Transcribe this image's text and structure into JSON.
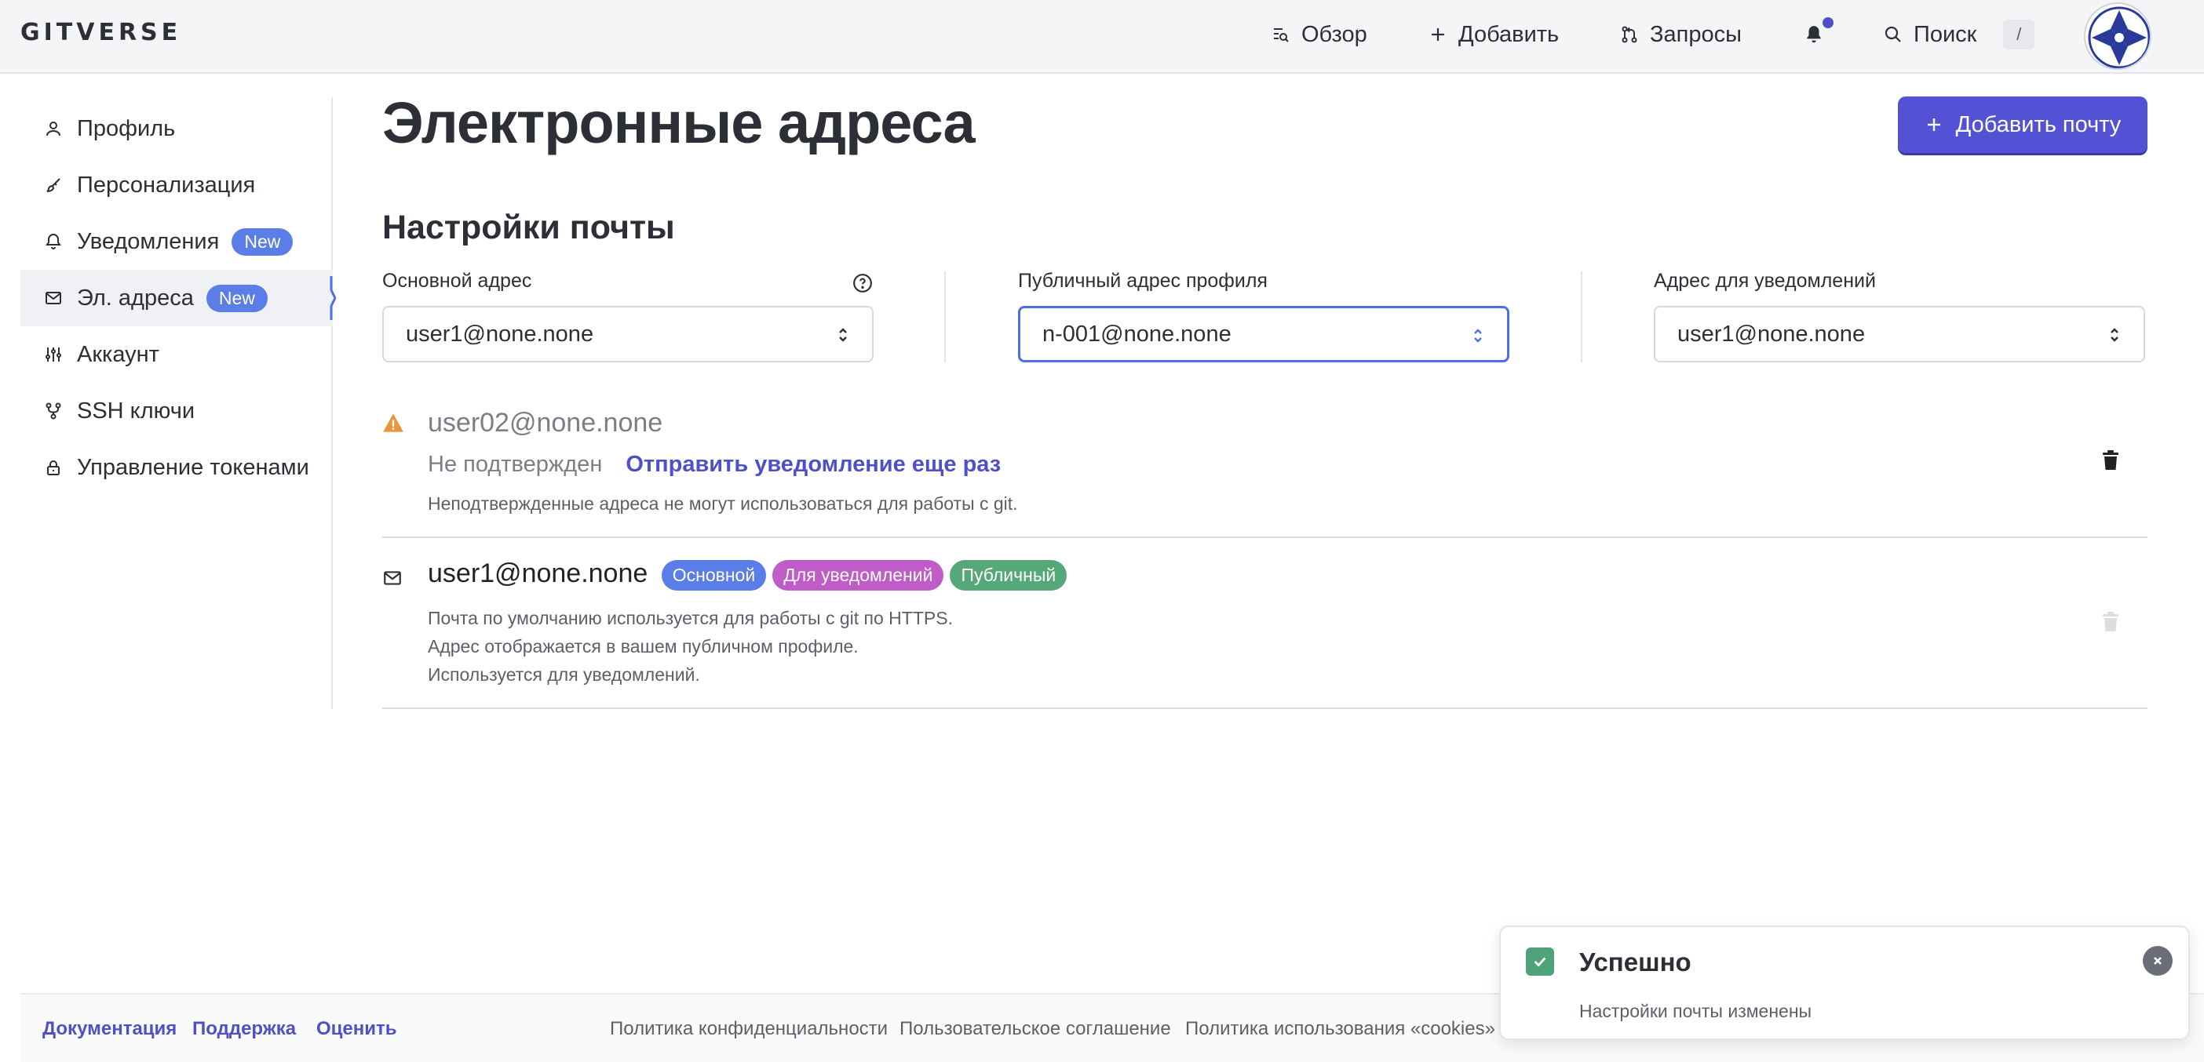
{
  "header": {
    "logo": "GITVERSE",
    "nav": {
      "overview": "Обзор",
      "add": "Добавить",
      "requests": "Запросы",
      "search": "Поиск",
      "search_shortcut": "/"
    },
    "icons": [
      "overview-icon",
      "plus-icon",
      "pull-request-icon",
      "bell-icon",
      "search-icon"
    ]
  },
  "sidebar": {
    "items": [
      {
        "label": "Профиль",
        "icon": "user-icon"
      },
      {
        "label": "Персонализация",
        "icon": "brush-icon"
      },
      {
        "label": "Уведомления",
        "icon": "bell-icon",
        "badge": "New"
      },
      {
        "label": "Эл. адреса",
        "icon": "mail-icon",
        "badge": "New",
        "active": true
      },
      {
        "label": "Аккаунт",
        "icon": "sliders-icon"
      },
      {
        "label": "SSH ключи",
        "icon": "key-branch-icon"
      },
      {
        "label": "Управление токенами",
        "icon": "lock-icon"
      }
    ]
  },
  "main": {
    "title": "Электронные адреса",
    "add_button": "Добавить почту",
    "settings_title": "Настройки почты",
    "fields": {
      "primary": {
        "label": "Основной адрес",
        "value": "user1@none.none"
      },
      "public": {
        "label": "Публичный адрес профиля",
        "value": "n-001@none.none"
      },
      "notify": {
        "label": "Адрес для уведомлений",
        "value": "user1@none.none"
      }
    },
    "emails": [
      {
        "address": "user02@none.none",
        "status": "Не подтвержден",
        "resend": "Отправить уведомление еще раз",
        "note": "Неподтвержденные адреса не могут использоваться для работы с git."
      },
      {
        "address": "user1@none.none",
        "badges": [
          "Основной",
          "Для уведомлений",
          "Публичный"
        ],
        "notes": [
          "Почта по умолчанию используется для работы с git по HTTPS.",
          "Адрес отображается в вашем публичном профиле.",
          "Используется для уведомлений."
        ]
      }
    ]
  },
  "footer": {
    "links": [
      "Документация",
      "Поддержка",
      "Оценить"
    ],
    "legal": [
      "Политика конфиденциальности",
      "Пользовательское соглашение",
      "Политика использования «cookies»"
    ]
  },
  "toast": {
    "title": "Успешно",
    "message": "Настройки почты изменены"
  },
  "colors": {
    "accent": "#5352d4",
    "badge_primary": "#5b7de8",
    "badge_notify": "#c05cc8",
    "badge_public": "#56a878",
    "warning": "#e8963c",
    "success": "#4fa37a"
  }
}
